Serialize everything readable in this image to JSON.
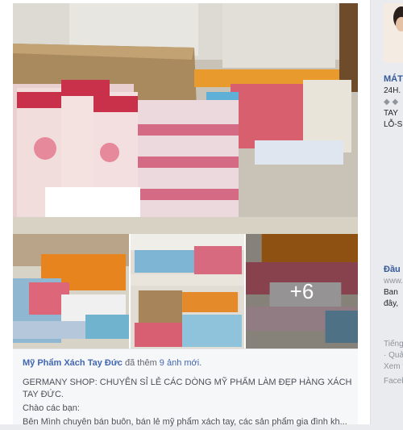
{
  "post": {
    "page_name": "Mỹ Phẩm Xách Tay Đức",
    "added_text": "đã thêm",
    "photo_count_text": "9 ảnh mới.",
    "more_photos": "+6",
    "body_lines": [
      "GERMANY SHOP: CHUYÊN SỈ LẺ CÁC DÒNG MỸ PHẨM LÀM ĐẸP HÀNG XÁCH TAY ĐỨC.",
      "Chào các bạn:",
      "Bên Mình chuyên bán buôn, bán lẻ mỹ phẩm xách tay, các sản phẩm gia đình kh..."
    ]
  },
  "sidebar": {
    "lines_top": [
      "MÁT",
      "24H.",
      "◆ ◆",
      "TAY",
      "LỖ-S"
    ],
    "lines_mid": [
      "Đầu",
      "www.",
      "Ban",
      "đây,"
    ],
    "lines_bottom": [
      "Tiếng",
      "· Quả",
      "Xem t",
      "Faceb"
    ]
  },
  "colors": {
    "link": "#4267b2",
    "text": "#4b4f56",
    "caption_bg": "#f6f7f9"
  }
}
